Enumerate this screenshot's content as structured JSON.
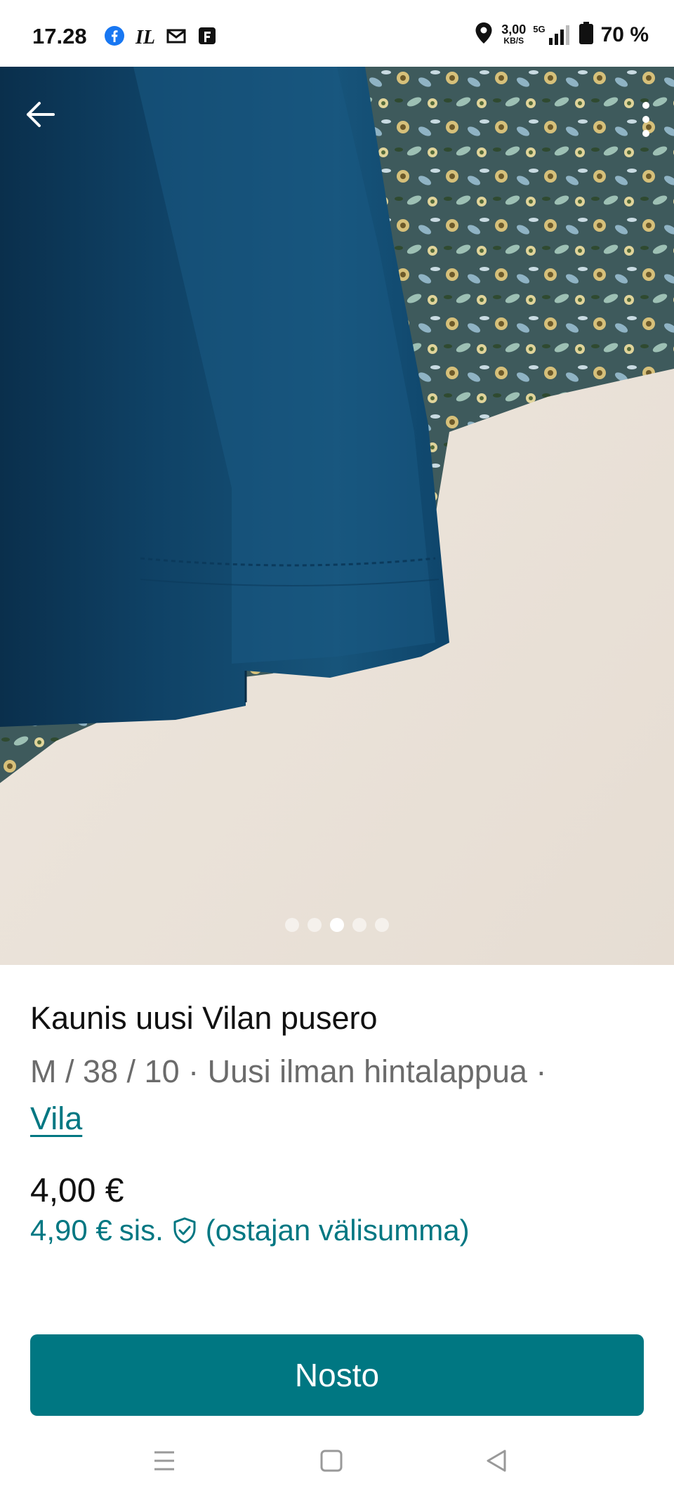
{
  "status_bar": {
    "time": "17.28",
    "network_speed": "3,00",
    "network_speed_unit": "KB/S",
    "network_type": "5G",
    "battery": "70 %",
    "notification_icons": [
      "facebook-icon",
      "il-app-icon",
      "gmail-icon",
      "f-app-icon"
    ]
  },
  "gallery": {
    "total_images": 5,
    "active_index": 2
  },
  "product": {
    "title": "Kaunis uusi Vilan pusero",
    "size_condition": "M / 38 / 10 · Uusi ilman hintalappua ·",
    "brand": "Vila",
    "price": "4,00 €",
    "buyer_price": "4,90 €",
    "buyer_price_incl": "sis.",
    "buyer_price_note": "(ostajan välisumma)"
  },
  "actions": {
    "primary_label": "Nosto"
  },
  "colors": {
    "accent": "#007782"
  }
}
